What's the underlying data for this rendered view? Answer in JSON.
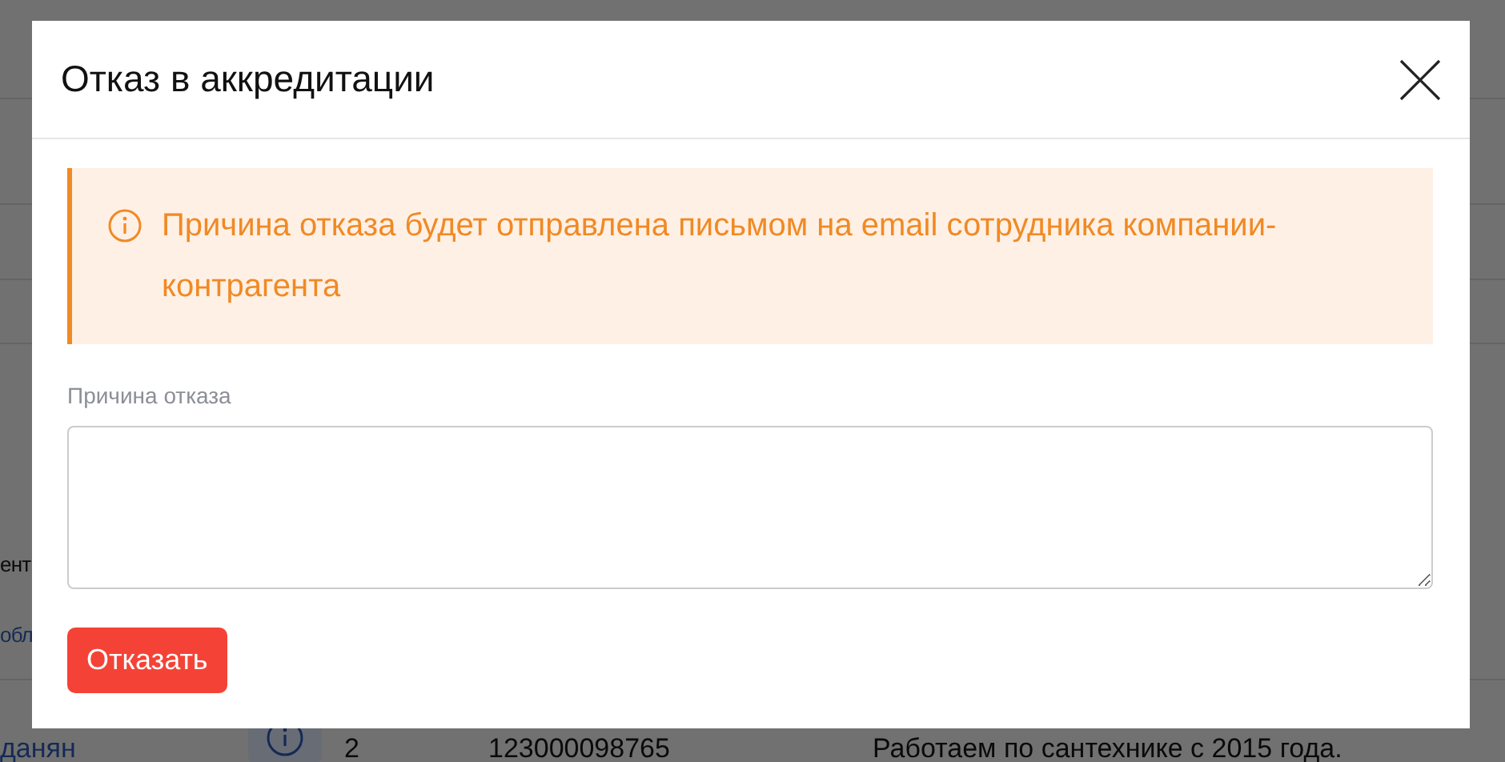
{
  "background": {
    "rows": [
      {
        "kind": "text",
        "text": "ент"
      },
      {
        "kind": "link",
        "text": "обл"
      },
      {
        "kind": "record",
        "name": "данян",
        "count": "2",
        "number": "123000098765",
        "description": "Работаем по сантехнике с 2015 года."
      }
    ]
  },
  "dialog": {
    "title": "Отказ в аккредитации",
    "notice": "Причина отказа будет отправлена письмом на email сотрудника компании-контрагента",
    "field": {
      "label": "Причина отказа"
    },
    "submit_button": "Отказать"
  }
}
